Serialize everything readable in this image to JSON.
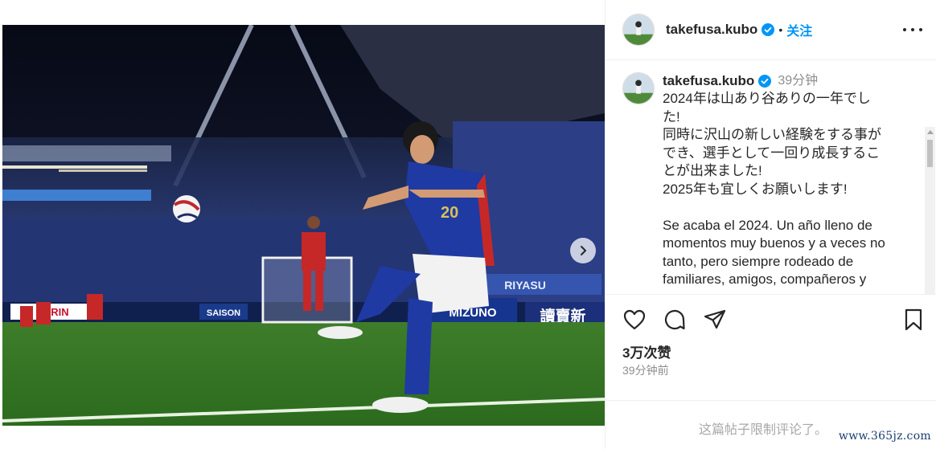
{
  "post": {
    "username": "takefusa.kubo",
    "follow_label": "关注",
    "separator": "•",
    "time_ago": "39分钟",
    "caption_lines": [
      "2024年は山あり谷ありの一年でし",
      "た!",
      "同時に沢山の新しい経験をする事が",
      "でき、選手として一回り成長するこ",
      "とが出来ました!",
      "2025年も宜しくお願いします!",
      "",
      "Se acaba el 2024. Un año lleno de",
      "momentos muy buenos y a veces no",
      "tanto, pero siempre rodeado de",
      "familiares, amigos, compañeros y"
    ],
    "views": "3万次赞",
    "posted": "39分钟前",
    "comments_disabled": "这篇帖子限制评论了。",
    "watermark": "www.365jz.com"
  },
  "photo": {
    "jersey_number": "20",
    "boards": [
      "KIRIN",
      "SAISON",
      "MIZUNO",
      "讀賣新",
      "RIYASU"
    ]
  },
  "colors": {
    "accent": "#0095f6",
    "verified": "#0095f6",
    "muted": "#8e8e8e",
    "border": "#efefef"
  },
  "icons": {
    "like": "heart-icon",
    "comment": "comment-icon",
    "share": "paper-plane-icon",
    "save": "bookmark-icon",
    "more": "more-horizontal-icon",
    "next": "chevron-right-icon",
    "verified": "verified-badge-icon"
  }
}
